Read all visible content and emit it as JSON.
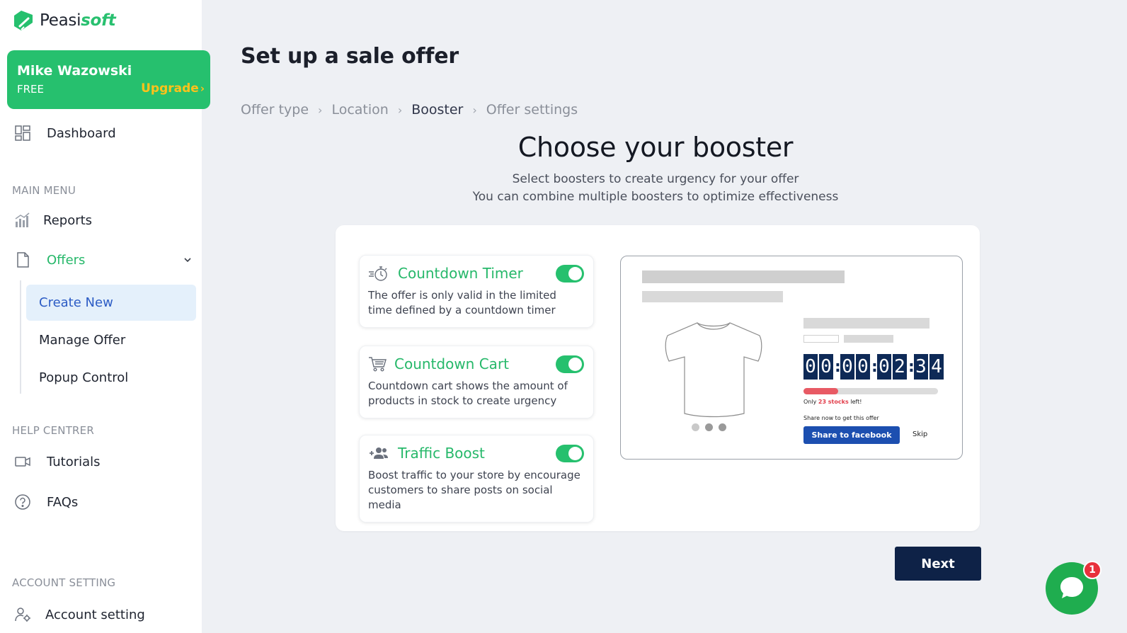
{
  "brand": {
    "name_part1": "Peasi",
    "name_part2": "soft"
  },
  "user": {
    "name": "Mike Wazowski",
    "plan": "FREE",
    "upgrade_label": "Upgrade"
  },
  "sidebar": {
    "dashboard": "Dashboard",
    "main_menu_label": "MAIN MENU",
    "reports": "Reports",
    "offers": "Offers",
    "offers_sub": [
      "Create New",
      "Manage Offer",
      "Popup Control"
    ],
    "help_label": "HELP CENTRER",
    "tutorials": "Tutorials",
    "faqs": "FAQs",
    "account_label": "ACCOUNT SETTING",
    "account_setting": "Account setting"
  },
  "main": {
    "title": "Set up a sale offer",
    "breadcrumb": [
      "Offer type",
      "Location",
      "Booster",
      "Offer settings"
    ],
    "active_step": 2,
    "heading": "Choose your booster",
    "subtitle_1": "Select boosters to create urgency for your offer",
    "subtitle_2": "You can combine multiple boosters to optimize effectiveness",
    "boosters": [
      {
        "title": "Countdown Timer",
        "desc": "The offer is only valid in the limited time defined by a countdown timer",
        "icon": "stopwatch-icon",
        "enabled": true
      },
      {
        "title": "Countdown Cart",
        "desc": "Countdown cart shows the amount of products in stock to create urgency",
        "icon": "cart-icon",
        "enabled": true
      },
      {
        "title": "Traffic Boost",
        "desc": "Boost traffic to your store by encourage customers to share posts on social media",
        "icon": "add-users-icon",
        "enabled": true
      }
    ],
    "preview": {
      "timer_digits": [
        "0",
        "0",
        "0",
        "0",
        "0",
        "2",
        "3",
        "4"
      ],
      "stock_prefix": "Only ",
      "stock_count": "23 stocks",
      "stock_suffix": " left!",
      "stock_fraction": 0.26,
      "share_text": "Share now to get this offer",
      "share_button": "Share to facebook",
      "skip": "Skip"
    },
    "next_label": "Next"
  },
  "chat": {
    "badge_count": "1"
  },
  "colors": {
    "accent_green": "#26c06e",
    "navy": "#0e2247",
    "upgrade_yellow": "#ffc21a",
    "link_blue": "#2c5cc5"
  }
}
